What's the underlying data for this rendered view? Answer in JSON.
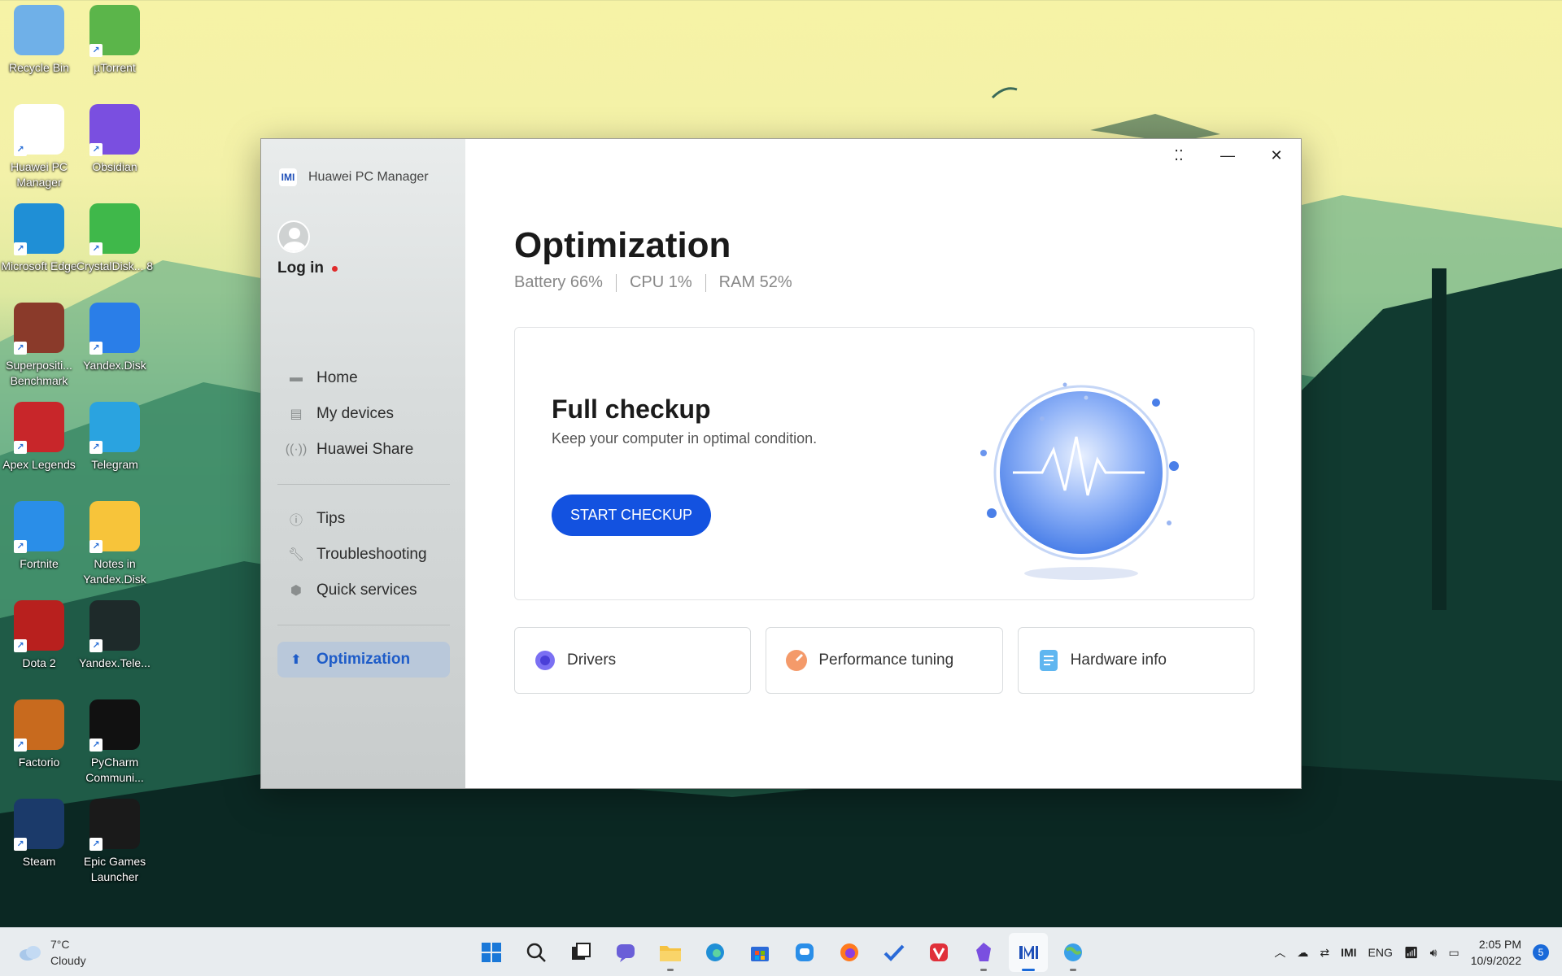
{
  "desktop": {
    "icons": [
      {
        "label": "Recycle Bin",
        "icon": "recycle-bin-icon",
        "color": "#6fb0e8"
      },
      {
        "label": "µTorrent",
        "icon": "utorrent-icon",
        "color": "#5bb54a"
      },
      {
        "label": "Huawei PC Manager",
        "icon": "huawei-pc-manager-icon",
        "color": "#ffffff"
      },
      {
        "label": "Obsidian",
        "icon": "obsidian-icon",
        "color": "#7a4fe0"
      },
      {
        "label": "Microsoft Edge",
        "icon": "edge-icon",
        "color": "#1f8fd6"
      },
      {
        "label": "CrystalDisk... 8",
        "icon": "crystaldisk-icon",
        "color": "#3fb84a"
      },
      {
        "label": "Superpositi... Benchmark",
        "icon": "superposition-icon",
        "color": "#8a3a2a"
      },
      {
        "label": "Yandex.Disk",
        "icon": "yandex-disk-icon",
        "color": "#2a7ee8"
      },
      {
        "label": "Apex Legends",
        "icon": "apex-legends-icon",
        "color": "#c8262a"
      },
      {
        "label": "Telegram",
        "icon": "telegram-icon",
        "color": "#2aa3e0"
      },
      {
        "label": "Fortnite",
        "icon": "fortnite-icon",
        "color": "#2a8ee8"
      },
      {
        "label": "Notes in Yandex.Disk",
        "icon": "notes-icon",
        "color": "#f7c43a"
      },
      {
        "label": "Dota 2",
        "icon": "dota2-icon",
        "color": "#b8201e"
      },
      {
        "label": "Yandex.Tele...",
        "icon": "yandex-tele-icon",
        "color": "#1e2a2a"
      },
      {
        "label": "Factorio",
        "icon": "factorio-icon",
        "color": "#c86a1e"
      },
      {
        "label": "PyCharm Communi...",
        "icon": "pycharm-icon",
        "color": "#111111"
      },
      {
        "label": "Steam",
        "icon": "steam-icon",
        "color": "#1b3a6a"
      },
      {
        "label": "Epic Games Launcher",
        "icon": "epic-games-icon",
        "color": "#1a1a1a"
      }
    ]
  },
  "app": {
    "title": "Huawei PC Manager",
    "logo_text": "IMI",
    "login_label": "Log in",
    "nav_primary": [
      {
        "label": "Home",
        "icon": "home-icon"
      },
      {
        "label": "My devices",
        "icon": "devices-icon"
      },
      {
        "label": "Huawei Share",
        "icon": "share-icon"
      }
    ],
    "nav_secondary": [
      {
        "label": "Tips",
        "icon": "tips-icon"
      },
      {
        "label": "Troubleshooting",
        "icon": "wrench-icon"
      },
      {
        "label": "Quick services",
        "icon": "shield-icon"
      }
    ],
    "nav_active": {
      "label": "Optimization",
      "icon": "optimization-icon"
    },
    "page_title": "Optimization",
    "stats": {
      "battery": "Battery 66%",
      "cpu": "CPU 1%",
      "ram": "RAM 52%"
    },
    "checkup": {
      "title": "Full checkup",
      "subtitle": "Keep your computer in optimal condition.",
      "button": "START CHECKUP"
    },
    "tiles": [
      {
        "label": "Drivers",
        "icon": "gear-icon",
        "color": "#6a5ff0"
      },
      {
        "label": "Performance tuning",
        "icon": "gauge-icon",
        "color": "#f07a4a"
      },
      {
        "label": "Hardware info",
        "icon": "document-icon",
        "color": "#3aa0e8"
      }
    ],
    "accent": "#1352e0"
  },
  "taskbar": {
    "weather_temp": "7°C",
    "weather_desc": "Cloudy",
    "language": "ENG",
    "time": "2:05 PM",
    "date": "10/9/2022",
    "notification_count": "5"
  }
}
